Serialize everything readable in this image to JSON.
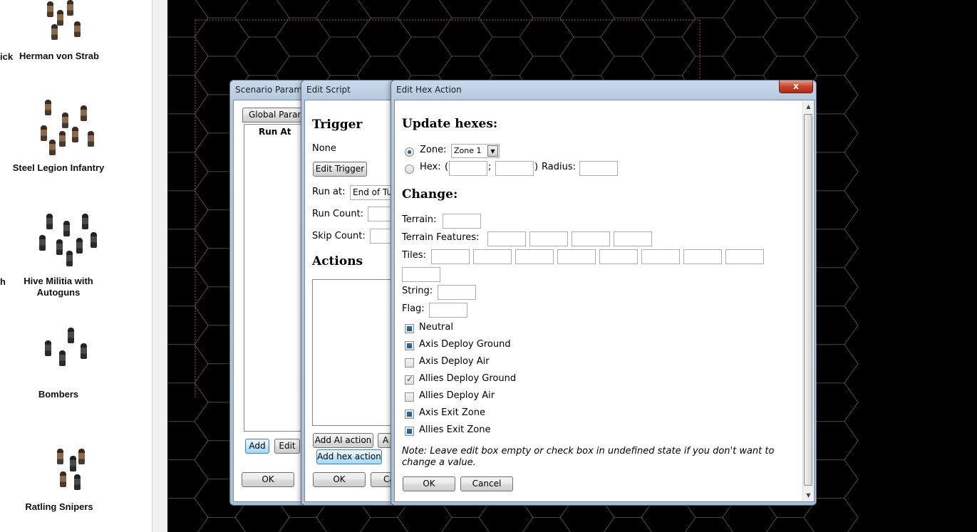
{
  "palette": {
    "units": [
      {
        "name": "Herman von Strab",
        "icon": "soldier-squad-icon"
      },
      {
        "name": "Steel Legion Infantry",
        "icon": "soldier-squad-icon"
      },
      {
        "name": "Hive Militia with Autoguns",
        "icon": "soldier-squad-icon"
      },
      {
        "name": "Bombers",
        "icon": "soldier-squad-icon"
      },
      {
        "name": "Ratling Snipers",
        "icon": "soldier-squad-icon"
      }
    ],
    "cut_labels": [
      "ick",
      "h"
    ]
  },
  "scenario_params": {
    "title": "Scenario Params",
    "tab_label": "Global Parame",
    "list_header": "Run At",
    "add_label": "Add",
    "edit_label": "Edit",
    "ok_label": "OK"
  },
  "edit_script": {
    "title": "Edit Script",
    "trigger_heading": "Trigger",
    "trigger_value": "None",
    "edit_trigger_label": "Edit Trigger",
    "run_at_label": "Run at:",
    "run_at_value": "End of Tur",
    "run_count_label": "Run Count:",
    "skip_count_label": "Skip Count:",
    "actions_heading": "Actions",
    "add_ai_action_label": "Add AI action",
    "add_hex_action_label": "Add hex action",
    "second_button_label": "A",
    "ok_label": "OK",
    "cancel_label": "Ca"
  },
  "edit_hex_action": {
    "title": "Edit Hex Action",
    "close_symbol": "x",
    "update_heading": "Update hexes:",
    "zone_label": "Zone:",
    "zone_value": "Zone 1",
    "hex_label": "Hex:",
    "hex_open": "(",
    "hex_sep": ";",
    "hex_close": ")",
    "radius_label": "Radius:",
    "change_heading": "Change:",
    "terrain_label": "Terrain:",
    "terrain_features_label": "Terrain Features:",
    "tiles_label": "Tiles:",
    "string_label": "String:",
    "flag_label": "Flag:",
    "checkboxes": [
      {
        "label": "Neutral",
        "state": "indeterminate"
      },
      {
        "label": "Axis Deploy Ground",
        "state": "indeterminate"
      },
      {
        "label": "Axis Deploy Air",
        "state": "unchecked"
      },
      {
        "label": "Allies Deploy Ground",
        "state": "checked"
      },
      {
        "label": "Allies Deploy Air",
        "state": "unchecked"
      },
      {
        "label": "Axis Exit Zone",
        "state": "indeterminate"
      },
      {
        "label": "Allies Exit Zone",
        "state": "indeterminate"
      }
    ],
    "note": "Note: Leave edit box empty or check box in undefined state if you don't want to change a value.",
    "ok_label": "OK",
    "cancel_label": "Cancel"
  },
  "colors": {
    "hex_grid": "#4a4a4a",
    "map_border": "#b05030",
    "indeterminate_fill": "#1f5c8a"
  }
}
